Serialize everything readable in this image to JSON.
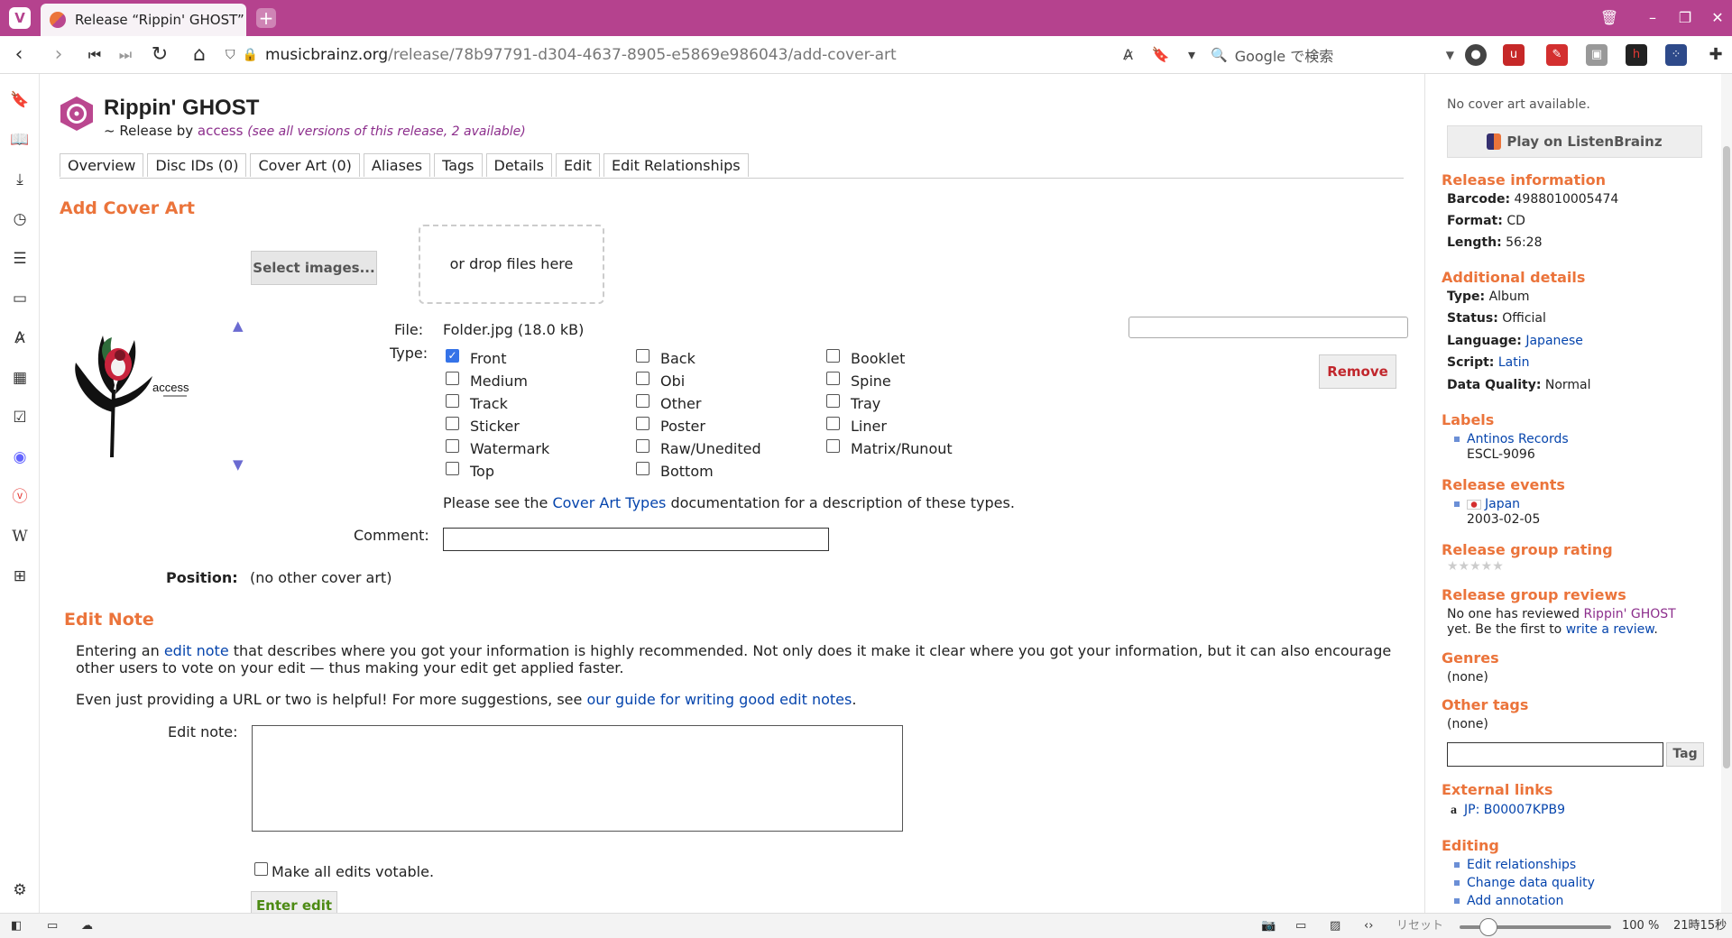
{
  "browser": {
    "tab_title": "Release “Rippin' GHOST” b",
    "url_host": "musicbrainz.org",
    "url_path": "/release/78b97791-d304-4637-8905-e5869e986043/add-cover-art",
    "search_placeholder": "Google で検索",
    "status": {
      "reset": "リセット",
      "zoom": "100 %",
      "time": "21時15秒"
    }
  },
  "header": {
    "title": "Rippin' GHOST",
    "subtitle_prefix": "~ Release by ",
    "artist": "access",
    "versions_note": "(see all versions of this release, 2 available)"
  },
  "tabs": [
    "Overview",
    "Disc IDs (0)",
    "Cover Art (0)",
    "Aliases",
    "Tags",
    "Details",
    "Edit",
    "Edit Relationships"
  ],
  "add_cover_art": {
    "heading": "Add Cover Art",
    "select_button": "Select images...",
    "drop_text": "or drop files here",
    "thumbnail_text": "access",
    "file_label": "File:",
    "file_value": "Folder.jpg (18.0 kB)",
    "type_label": "Type:",
    "types": [
      {
        "label": "Front",
        "checked": true
      },
      {
        "label": "Medium",
        "checked": false
      },
      {
        "label": "Track",
        "checked": false
      },
      {
        "label": "Sticker",
        "checked": false
      },
      {
        "label": "Watermark",
        "checked": false
      },
      {
        "label": "Top",
        "checked": false
      },
      {
        "label": "Back",
        "checked": false
      },
      {
        "label": "Obi",
        "checked": false
      },
      {
        "label": "Other",
        "checked": false
      },
      {
        "label": "Poster",
        "checked": false
      },
      {
        "label": "Raw/Unedited",
        "checked": false
      },
      {
        "label": "Bottom",
        "checked": false
      },
      {
        "label": "Booklet",
        "checked": false
      },
      {
        "label": "Spine",
        "checked": false
      },
      {
        "label": "Tray",
        "checked": false
      },
      {
        "label": "Liner",
        "checked": false
      },
      {
        "label": "Matrix/Runout",
        "checked": false
      }
    ],
    "types_note_prefix": "Please see the ",
    "types_note_link": "Cover Art Types",
    "types_note_suffix": " documentation for a description of these types.",
    "remove_button": "Remove",
    "comment_label": "Comment:",
    "position_label": "Position:",
    "position_value": "(no other cover art)"
  },
  "edit_note": {
    "heading": "Edit Note",
    "para1_a": "Entering an ",
    "para1_link": "edit note",
    "para1_b": " that describes where you got your information is highly recommended. Not only does it make it clear where you got your information, but it can also encourage other users to vote on your edit — thus making your edit get applied faster.",
    "para2_a": "Even just providing a URL or two is helpful! For more suggestions, see ",
    "para2_link": "our guide for writing good edit notes",
    "para2_b": ".",
    "label": "Edit note:",
    "votable_label": "Make all edits votable.",
    "enter_button": "Enter edit"
  },
  "sidebar": {
    "no_cover": "No cover art available.",
    "listenbrainz": "Play on ListenBrainz",
    "release_info_heading": "Release information",
    "barcode_label": "Barcode:",
    "barcode": "4988010005474",
    "format_label": "Format:",
    "format": "CD",
    "length_label": "Length:",
    "length": "56:28",
    "additional_heading": "Additional details",
    "type_label": "Type:",
    "type": "Album",
    "status_label": "Status:",
    "status": "Official",
    "language_label": "Language:",
    "language": "Japanese",
    "script_label": "Script:",
    "script": "Latin",
    "quality_label": "Data Quality:",
    "quality": "Normal",
    "labels_heading": "Labels",
    "label_name": "Antinos Records",
    "catalog": "ESCL-9096",
    "events_heading": "Release events",
    "event_country": "Japan",
    "event_date": "2003-02-05",
    "rating_heading": "Release group rating",
    "stars": "★★★★★",
    "reviews_heading": "Release group reviews",
    "reviews_a": "No one has reviewed ",
    "reviews_link": "Rippin' GHOST",
    "reviews_b": "yet. Be the first to ",
    "reviews_link2": "write a review",
    "reviews_c": ".",
    "genres_heading": "Genres",
    "genres": "(none)",
    "othertags_heading": "Other tags",
    "othertags": "(none)",
    "tag_button": "Tag",
    "external_heading": "External links",
    "external_link": "JP: B00007KPB9",
    "editing_heading": "Editing",
    "edit_links": [
      "Edit relationships",
      "Change data quality",
      "Add annotation"
    ]
  }
}
